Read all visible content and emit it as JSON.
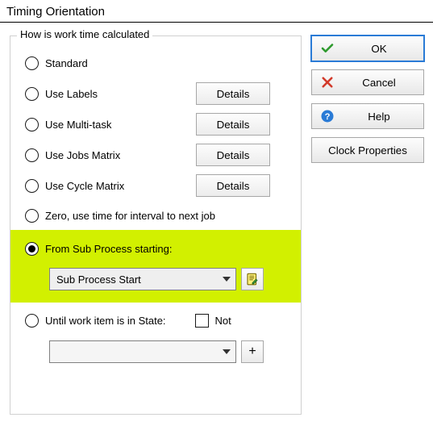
{
  "window": {
    "title": "Timing Orientation"
  },
  "group": {
    "legend": "How is work time calculated",
    "options": {
      "standard": "Standard",
      "use_labels": "Use Labels",
      "use_multitask": "Use Multi-task",
      "use_jobs_matrix": "Use Jobs Matrix",
      "use_cycle_matrix": "Use Cycle Matrix",
      "zero": "Zero, use time for interval to next job",
      "from_sub": "From Sub Process starting:",
      "until_state": "Until work item is in State:",
      "not": "Not"
    },
    "details_label": "Details",
    "sub_process_selected": "Sub Process Start",
    "plus_label": "+"
  },
  "buttons": {
    "ok": "OK",
    "cancel": "Cancel",
    "help": "Help",
    "clock": "Clock Properties"
  },
  "colors": {
    "highlight": "#d2f000",
    "focus": "#2a7bd6"
  }
}
